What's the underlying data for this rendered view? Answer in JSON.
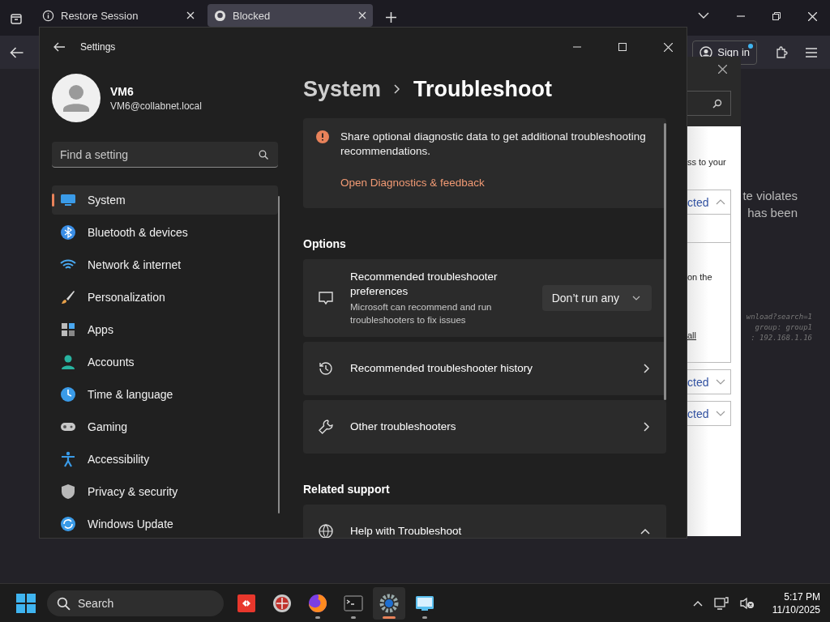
{
  "browser": {
    "tabs": [
      {
        "title": "Restore Session",
        "selected": false
      },
      {
        "title": "Blocked",
        "selected": true
      }
    ],
    "sign_in": "Sign in",
    "page_lines": [
      "te violates",
      "has been"
    ],
    "code_lines": [
      "wnload?search=1",
      "group: group1",
      ": 192.168.1.16"
    ]
  },
  "dialog": {
    "intro": "ss to your",
    "sections": [
      {
        "label": "cted",
        "expanded": true,
        "lines": [
          "on the",
          "all"
        ]
      },
      {
        "label": "cted",
        "expanded": false
      },
      {
        "label": "cted",
        "expanded": false
      }
    ]
  },
  "settings": {
    "title": "Settings",
    "user": {
      "name": "VM6",
      "email": "VM6@collabnet.local"
    },
    "search": {
      "placeholder": "Find a setting"
    },
    "nav": [
      {
        "label": "System",
        "selected": true
      },
      {
        "label": "Bluetooth & devices",
        "selected": false
      },
      {
        "label": "Network & internet",
        "selected": false
      },
      {
        "label": "Personalization",
        "selected": false
      },
      {
        "label": "Apps",
        "selected": false
      },
      {
        "label": "Accounts",
        "selected": false
      },
      {
        "label": "Time & language",
        "selected": false
      },
      {
        "label": "Gaming",
        "selected": false
      },
      {
        "label": "Accessibility",
        "selected": false
      },
      {
        "label": "Privacy & security",
        "selected": false
      },
      {
        "label": "Windows Update",
        "selected": false
      }
    ],
    "breadcrumb": [
      "System",
      "Troubleshoot"
    ],
    "notice": {
      "text": "Share optional diagnostic data to get additional troubleshooting recommendations.",
      "link": "Open Diagnostics & feedback"
    },
    "options_heading": "Options",
    "options": [
      {
        "kind": "dropdown",
        "title": "Recommended troubleshooter preferences",
        "description": "Microsoft can recommend and run troubleshooters to fix issues",
        "value": "Don’t run any"
      },
      {
        "kind": "link",
        "title": "Recommended troubleshooter history"
      },
      {
        "kind": "link",
        "title": "Other troubleshooters"
      }
    ],
    "related_heading": "Related support",
    "related": [
      {
        "kind": "expander",
        "title": "Help with Troubleshoot",
        "expanded": true
      }
    ]
  },
  "taskbar": {
    "search_placeholder": "Search",
    "apps": [
      {
        "running": false,
        "active": false
      },
      {
        "running": false,
        "active": false
      },
      {
        "running": true,
        "active": false
      },
      {
        "running": true,
        "active": false
      },
      {
        "running": true,
        "active": true
      },
      {
        "running": true,
        "active": false
      }
    ],
    "time": "5:17 PM",
    "date": "11/10/2025"
  }
}
